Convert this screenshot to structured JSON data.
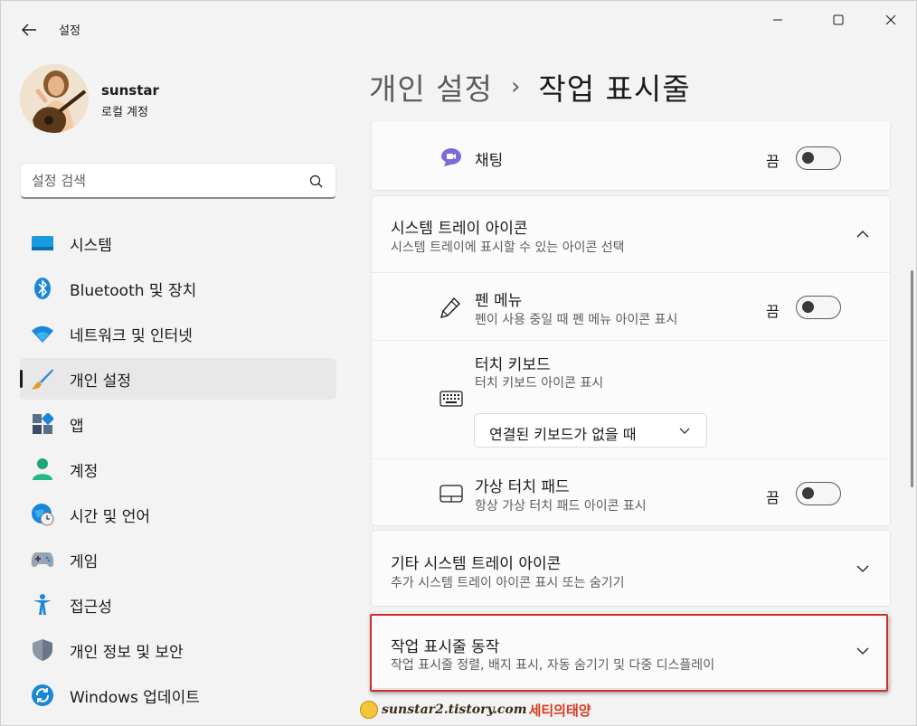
{
  "window": {
    "app_title": "설정",
    "controls": [
      "minimize",
      "maximize",
      "close"
    ]
  },
  "profile": {
    "name": "sunstar",
    "account_type": "로컬 계정"
  },
  "search": {
    "placeholder": "설정 검색"
  },
  "sidebar": {
    "items": [
      {
        "label": "시스템",
        "icon": "system-icon"
      },
      {
        "label": "Bluetooth 및 장치",
        "icon": "bluetooth-icon"
      },
      {
        "label": "네트워크 및 인터넷",
        "icon": "wifi-icon"
      },
      {
        "label": "개인 설정",
        "icon": "brush-icon",
        "selected": true
      },
      {
        "label": "앱",
        "icon": "apps-icon"
      },
      {
        "label": "계정",
        "icon": "account-icon"
      },
      {
        "label": "시간 및 언어",
        "icon": "time-language-icon"
      },
      {
        "label": "게임",
        "icon": "gamepad-icon"
      },
      {
        "label": "접근성",
        "icon": "accessibility-icon"
      },
      {
        "label": "개인 정보 및 보안",
        "icon": "shield-icon"
      },
      {
        "label": "Windows 업데이트",
        "icon": "update-icon"
      }
    ]
  },
  "header": {
    "parent": "개인 설정",
    "separator": "›",
    "current": "작업 표시줄"
  },
  "content": {
    "chat": {
      "title": "채팅",
      "state": "끔",
      "on": false
    },
    "tray_section": {
      "title": "시스템 트레이 아이콘",
      "subtitle": "시스템 트레이에 표시할 수 있는 아이콘 선택",
      "expanded": true
    },
    "pen_menu": {
      "title": "펜 메뉴",
      "subtitle": "펜이 사용 중일 때 펜 메뉴 아이콘 표시",
      "state": "끔",
      "on": false
    },
    "touch_keyboard": {
      "title": "터치 키보드",
      "subtitle": "터치 키보드 아이콘 표시",
      "dropdown_value": "연결된 키보드가 없을 때"
    },
    "touchpad": {
      "title": "가상 터치 패드",
      "subtitle": "항상 가상 터치 패드 아이콘 표시",
      "state": "끔",
      "on": false
    },
    "other_tray": {
      "title": "기타 시스템 트레이 아이콘",
      "subtitle": "추가 시스템 트레이 아이콘 표시 또는 숨기기"
    },
    "behaviors": {
      "title": "작업 표시줄 동작",
      "subtitle": "작업 표시줄 정렬, 배지 표시, 자동 숨기기 및 다중 디스플레이"
    }
  },
  "watermark": {
    "url": "sunstar2.tistory.com",
    "name": "세티의태양"
  },
  "colors": {
    "accent": "#0067c0",
    "highlight_border": "#d42a2a",
    "background": "#f3f3f3",
    "card": "#fbfbfb"
  }
}
